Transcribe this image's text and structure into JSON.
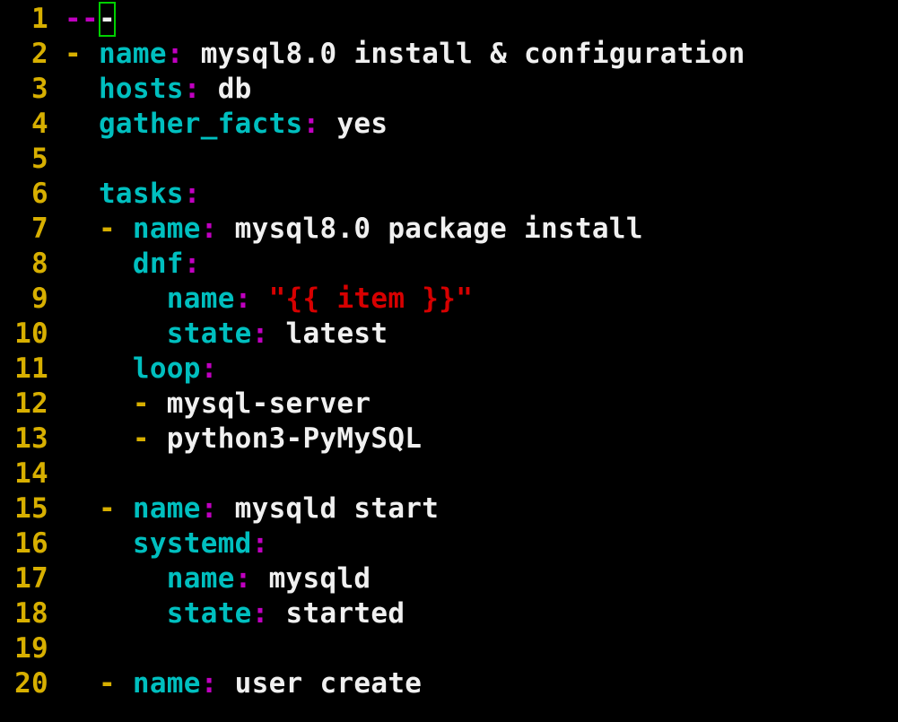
{
  "editor": {
    "lines": [
      {
        "n": "1",
        "indent": "",
        "dash": "",
        "key": "",
        "colon": "",
        "val": "",
        "doc_a": "--",
        "doc_b": "-"
      },
      {
        "n": "2",
        "indent": "",
        "dash": "- ",
        "key": "name",
        "colon": ":",
        "val": " mysql8.0 install & configuration"
      },
      {
        "n": "3",
        "indent": "  ",
        "dash": "",
        "key": "hosts",
        "colon": ":",
        "val": " db"
      },
      {
        "n": "4",
        "indent": "  ",
        "dash": "",
        "key": "gather_facts",
        "colon": ":",
        "val": " yes"
      },
      {
        "n": "5",
        "indent": "",
        "dash": "",
        "key": "",
        "colon": "",
        "val": ""
      },
      {
        "n": "6",
        "indent": "  ",
        "dash": "",
        "key": "tasks",
        "colon": ":",
        "val": ""
      },
      {
        "n": "7",
        "indent": "  ",
        "dash": "- ",
        "key": "name",
        "colon": ":",
        "val": " mysql8.0 package install"
      },
      {
        "n": "8",
        "indent": "    ",
        "dash": "",
        "key": "dnf",
        "colon": ":",
        "val": ""
      },
      {
        "n": "9",
        "indent": "      ",
        "dash": "",
        "key": "name",
        "colon": ":",
        "val": " ",
        "str": "\"{{ item }}\""
      },
      {
        "n": "10",
        "indent": "      ",
        "dash": "",
        "key": "state",
        "colon": ":",
        "val": " latest"
      },
      {
        "n": "11",
        "indent": "    ",
        "dash": "",
        "key": "loop",
        "colon": ":",
        "val": ""
      },
      {
        "n": "12",
        "indent": "    ",
        "dash": "- ",
        "key": "",
        "colon": "",
        "val": "mysql-server"
      },
      {
        "n": "13",
        "indent": "    ",
        "dash": "- ",
        "key": "",
        "colon": "",
        "val": "python3-PyMySQL"
      },
      {
        "n": "14",
        "indent": "",
        "dash": "",
        "key": "",
        "colon": "",
        "val": ""
      },
      {
        "n": "15",
        "indent": "  ",
        "dash": "- ",
        "key": "name",
        "colon": ":",
        "val": " mysqld start"
      },
      {
        "n": "16",
        "indent": "    ",
        "dash": "",
        "key": "systemd",
        "colon": ":",
        "val": ""
      },
      {
        "n": "17",
        "indent": "      ",
        "dash": "",
        "key": "name",
        "colon": ":",
        "val": " mysqld"
      },
      {
        "n": "18",
        "indent": "      ",
        "dash": "",
        "key": "state",
        "colon": ":",
        "val": " started"
      },
      {
        "n": "19",
        "indent": "",
        "dash": "",
        "key": "",
        "colon": "",
        "val": ""
      },
      {
        "n": "20",
        "indent": "  ",
        "dash": "- ",
        "key": "name",
        "colon": ":",
        "val": " user create"
      }
    ]
  },
  "colors": {
    "background": "#000000",
    "line_number": "#d7af00",
    "key": "#00bfbf",
    "colon": "#c000c0",
    "value": "#f0f0f0",
    "string": "#d70000",
    "cursor_outline": "#00d000"
  }
}
